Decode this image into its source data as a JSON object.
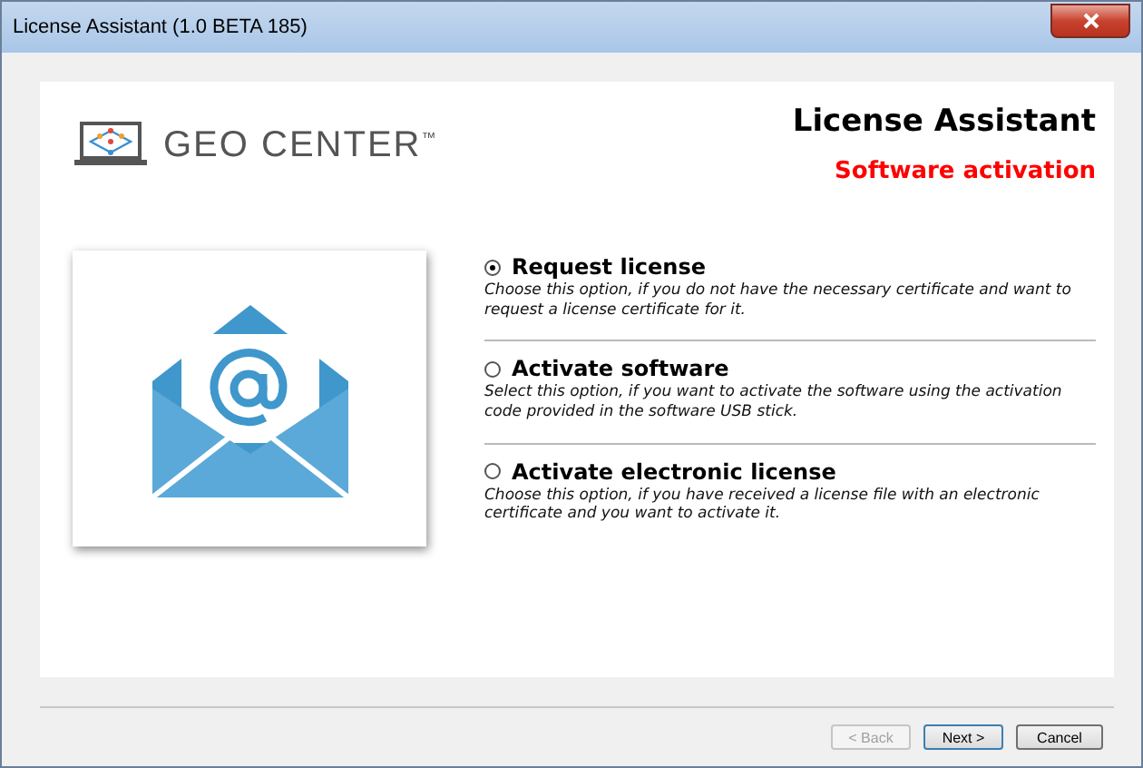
{
  "window": {
    "title": "License Assistant (1.0 BETA 185)"
  },
  "logo": {
    "text": "GEO CENTER$^{™}$"
  },
  "header": {
    "title": "License Assistant",
    "subtitle": "Software activation"
  },
  "options": [
    {
      "label": "Request license",
      "description": "Choose this option, if you do not have the necessary certificate and want to request a license certificate for it.",
      "selected": true
    },
    {
      "label": "Activate software",
      "description": "Select this option, if you want to activate the software using the activation code provided in the software USB stick.",
      "selected": false
    },
    {
      "label": "Activate electronic license",
      "description": "Choose this option, if you have received a license file with an electronic certificate and you want to activate it.",
      "selected": false
    }
  ],
  "buttons": [
    {
      "label": "< Back",
      "disabled": true,
      "default": false
    },
    {
      "label": "Next >",
      "disabled": false,
      "default": true
    },
    {
      "label": "Cancel",
      "disabled": false,
      "default": false
    }
  ]
}
